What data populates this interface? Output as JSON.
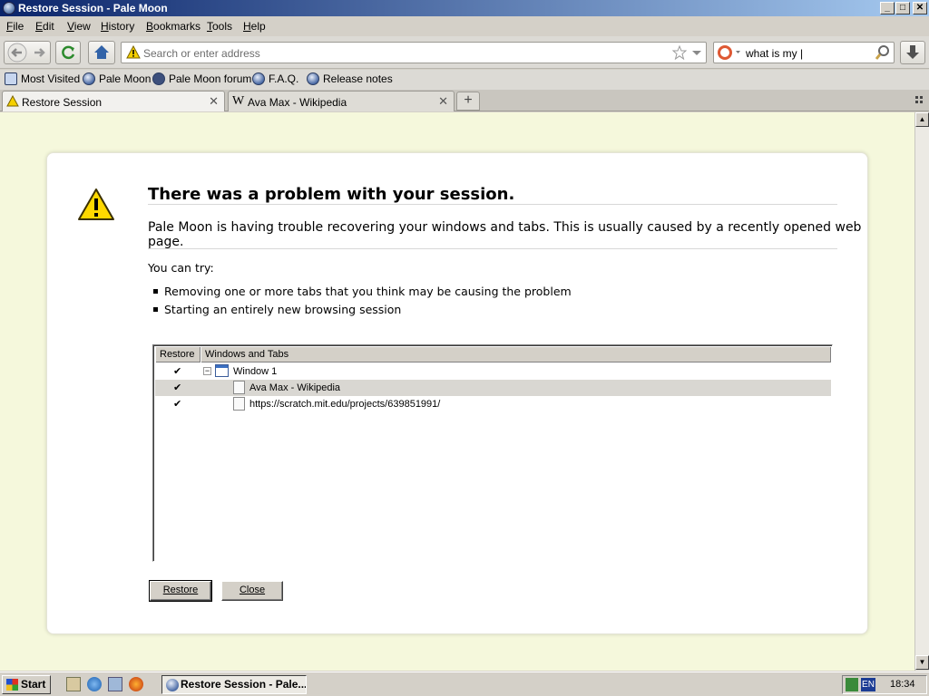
{
  "window": {
    "title": "Restore Session - Pale Moon",
    "min": "_",
    "max": "□",
    "close": "✕"
  },
  "menu": [
    {
      "label": "File",
      "key": "F",
      "rest": "ile"
    },
    {
      "label": "Edit",
      "key": "E",
      "rest": "dit"
    },
    {
      "label": "View",
      "key": "V",
      "rest": "iew"
    },
    {
      "label": "History",
      "key": "H",
      "rest": "istory"
    },
    {
      "label": "Bookmarks",
      "key": "B",
      "rest": "ookmarks"
    },
    {
      "label": "Tools",
      "key": "T",
      "rest": "ools"
    },
    {
      "label": "Help",
      "key": "H",
      "rest": "elp"
    }
  ],
  "navbar": {
    "url_placeholder": "Search or enter address",
    "search_value": "what is my |"
  },
  "bookmarks": [
    "Most Visited",
    "Pale Moon",
    "Pale Moon forum",
    "F.A.Q.",
    "Release notes"
  ],
  "tabs": [
    {
      "label": "Restore Session",
      "active": true
    },
    {
      "label": "Ava Max - Wikipedia",
      "active": false
    }
  ],
  "page": {
    "heading": "There was a problem with your session.",
    "description": "Pale Moon is having trouble recovering your windows and tabs. This is usually caused by a recently opened web page.",
    "try_label": "You can try:",
    "suggestions": [
      "Removing one or more tabs that you think may be causing the problem",
      "Starting an entirely new browsing session"
    ],
    "columns": {
      "restore": "Restore",
      "windows": "Windows and Tabs"
    },
    "window_label": "Window 1",
    "tab_rows": [
      {
        "label": "Ava Max - Wikipedia",
        "checked": true,
        "selected": true
      },
      {
        "label": "https://scratch.mit.edu/projects/639851991/",
        "checked": true,
        "selected": false
      }
    ],
    "restore_button": "Restore",
    "close_button": "Close"
  },
  "taskbar": {
    "start": "Start",
    "task": "Restore Session - Pale...",
    "lang": "EN",
    "clock": "18:34"
  }
}
